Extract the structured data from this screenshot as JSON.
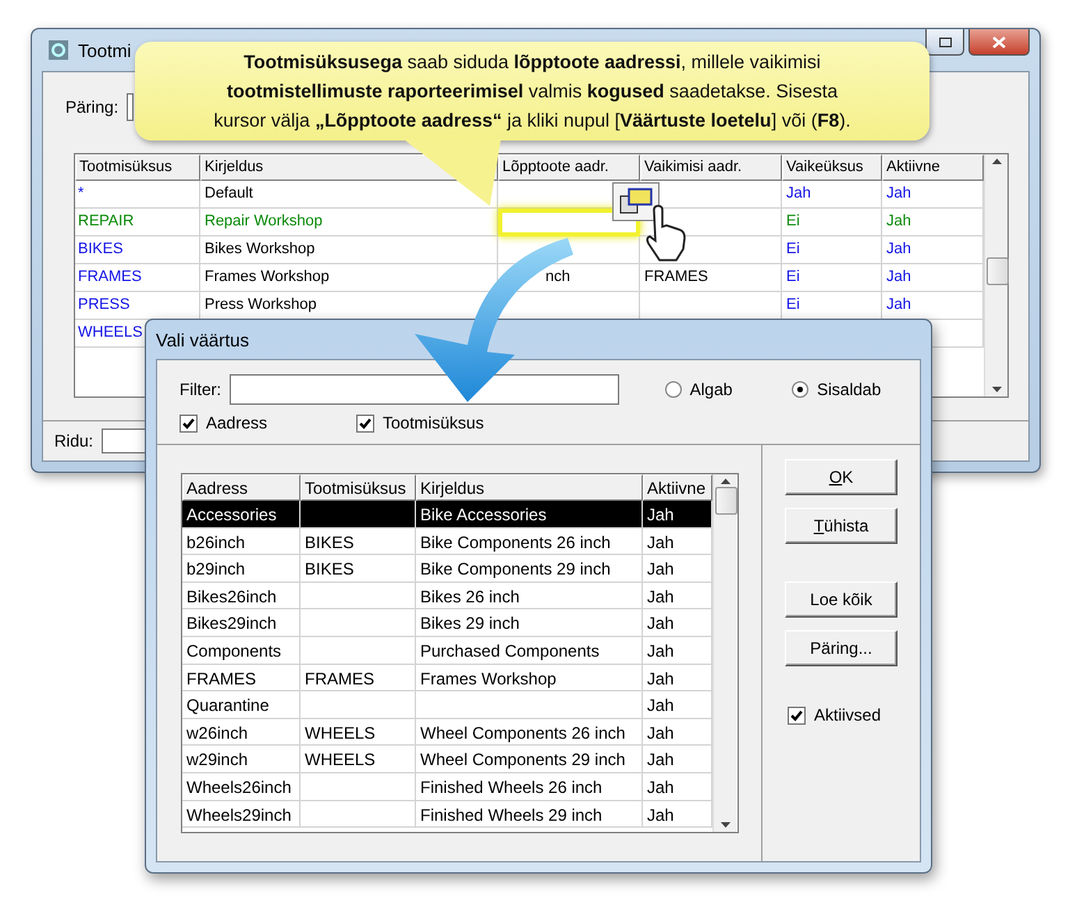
{
  "main_window": {
    "title": "Tootmi",
    "query_label": "Päring:",
    "grid": {
      "columns": [
        "Tootmisüksus",
        "Kirjeldus",
        "Lõpptoote aadr.",
        "Vaikimisi aadr.",
        "Vaikeüksus",
        "Aktiivne"
      ],
      "rows": [
        {
          "unit": "*",
          "description": "Default",
          "is_default": "Jah",
          "active": "Jah",
          "selected": false
        },
        {
          "unit": "REPAIR",
          "description": "Repair Workshop",
          "is_default": "Ei",
          "active": "Jah",
          "selected": true
        },
        {
          "unit": "BIKES",
          "description": "Bikes Workshop",
          "is_default": "Ei",
          "active": "Jah",
          "selected": false
        },
        {
          "unit": "FRAMES",
          "description": "Frames Workshop",
          "end_address": "nch",
          "default_address": "FRAMES",
          "is_default": "Ei",
          "active": "Jah",
          "selected": false
        },
        {
          "unit": "PRESS",
          "description": "Press Workshop",
          "is_default": "Ei",
          "active": "Jah",
          "selected": false
        },
        {
          "unit": "WHEELS",
          "selected": false
        }
      ]
    },
    "status_label": "Ridu:"
  },
  "callout": {
    "lines": [
      "**Tootmisüksusega** saab siduda **lõpptoote aadressi**, millele vaikimisi",
      "**tootmistellimuste raporteerimisel** valmis **kogused** saadetakse. Sisesta",
      "kursor välja **„Lõpptoote aadress“** ja kliki nupul [**Väärtuste loetelu**] või (**F8**)."
    ]
  },
  "dialog": {
    "title": "Vali väärtus",
    "filter_label": "Filter:",
    "match_options": [
      {
        "label": "Algab",
        "selected": false
      },
      {
        "label": "Sisaldab",
        "selected": true
      }
    ],
    "search_in": [
      {
        "label": "Aadress",
        "checked": true
      },
      {
        "label": "Tootmisüksus",
        "checked": true
      }
    ],
    "grid": {
      "columns": [
        "Aadress",
        "Tootmisüksus",
        "Kirjeldus",
        "Aktiivne"
      ],
      "rows": [
        {
          "address": "Accessories",
          "description": "Bike Accessories",
          "active": "Jah",
          "selected": true
        },
        {
          "address": "b26inch",
          "unit": "BIKES",
          "description": "Bike Components 26 inch",
          "active": "Jah",
          "selected": false
        },
        {
          "address": "b29inch",
          "unit": "BIKES",
          "description": "Bike Components 29 inch",
          "active": "Jah",
          "selected": false
        },
        {
          "address": "Bikes26inch",
          "description": "Bikes 26 inch",
          "active": "Jah",
          "selected": false
        },
        {
          "address": "Bikes29inch",
          "description": "Bikes 29 inch",
          "active": "Jah",
          "selected": false
        },
        {
          "address": "Components",
          "description": "Purchased Components",
          "active": "Jah",
          "selected": false
        },
        {
          "address": "FRAMES",
          "unit": "FRAMES",
          "description": "Frames Workshop",
          "active": "Jah",
          "selected": false
        },
        {
          "address": "Quarantine",
          "active": "Jah",
          "selected": false
        },
        {
          "address": "w26inch",
          "unit": "WHEELS",
          "description": "Wheel Components 26 inch",
          "active": "Jah",
          "selected": false
        },
        {
          "address": "w29inch",
          "unit": "WHEELS",
          "description": "Wheel Components 29 inch",
          "active": "Jah",
          "selected": false
        },
        {
          "address": "Wheels26inch",
          "description": "Finished Wheels 26 inch",
          "active": "Jah",
          "selected": false
        },
        {
          "address": "Wheels29inch",
          "description": "Finished Wheels 29 inch",
          "active": "Jah",
          "selected": false
        }
      ]
    },
    "buttons": [
      {
        "label": "OK",
        "mnemonic": true
      },
      {
        "label": "Tühista",
        "mnemonic": true
      },
      {
        "label": "Loe kõik",
        "mnemonic": false
      },
      {
        "label": "Päring...",
        "mnemonic": false
      }
    ],
    "active_only": {
      "label": "Aktiivsed",
      "checked": true
    }
  }
}
